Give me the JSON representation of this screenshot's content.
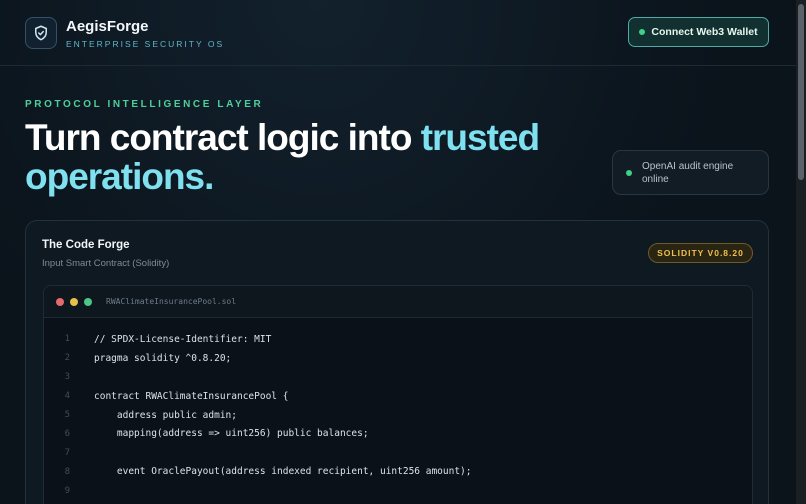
{
  "brand": {
    "name": "AegisForge",
    "tagline": "ENTERPRISE SECURITY OS",
    "logo_icon": "shield-check-icon"
  },
  "header": {
    "wallet_button": "Connect Web3 Wallet",
    "wallet_status_color": "#3fd08a"
  },
  "hero": {
    "eyebrow": "PROTOCOL INTELLIGENCE LAYER",
    "title_plain": "Turn contract logic into ",
    "title_accent": "trusted operations.",
    "accent_color": "#7fe0ef"
  },
  "engine_status": {
    "text": "OpenAI audit engine online",
    "status_color": "#3fd08a"
  },
  "forge": {
    "title": "The Code Forge",
    "subtitle": "Input Smart Contract (Solidity)",
    "badge": "SOLIDITY V0.8.20",
    "filename": "RWAClimateInsurancePool.sol",
    "code_lines": [
      {
        "n": "1",
        "text": "// SPDX-License-Identifier: MIT"
      },
      {
        "n": "2",
        "text": "pragma solidity ^0.8.20;"
      },
      {
        "n": "3",
        "text": ""
      },
      {
        "n": "4",
        "text": "contract RWAClimateInsurancePool {"
      },
      {
        "n": "5",
        "text": "    address public admin;"
      },
      {
        "n": "6",
        "text": "    mapping(address => uint256) public balances;"
      },
      {
        "n": "7",
        "text": ""
      },
      {
        "n": "8",
        "text": "    event OraclePayout(address indexed recipient, uint256 amount);"
      },
      {
        "n": "9",
        "text": ""
      }
    ]
  }
}
